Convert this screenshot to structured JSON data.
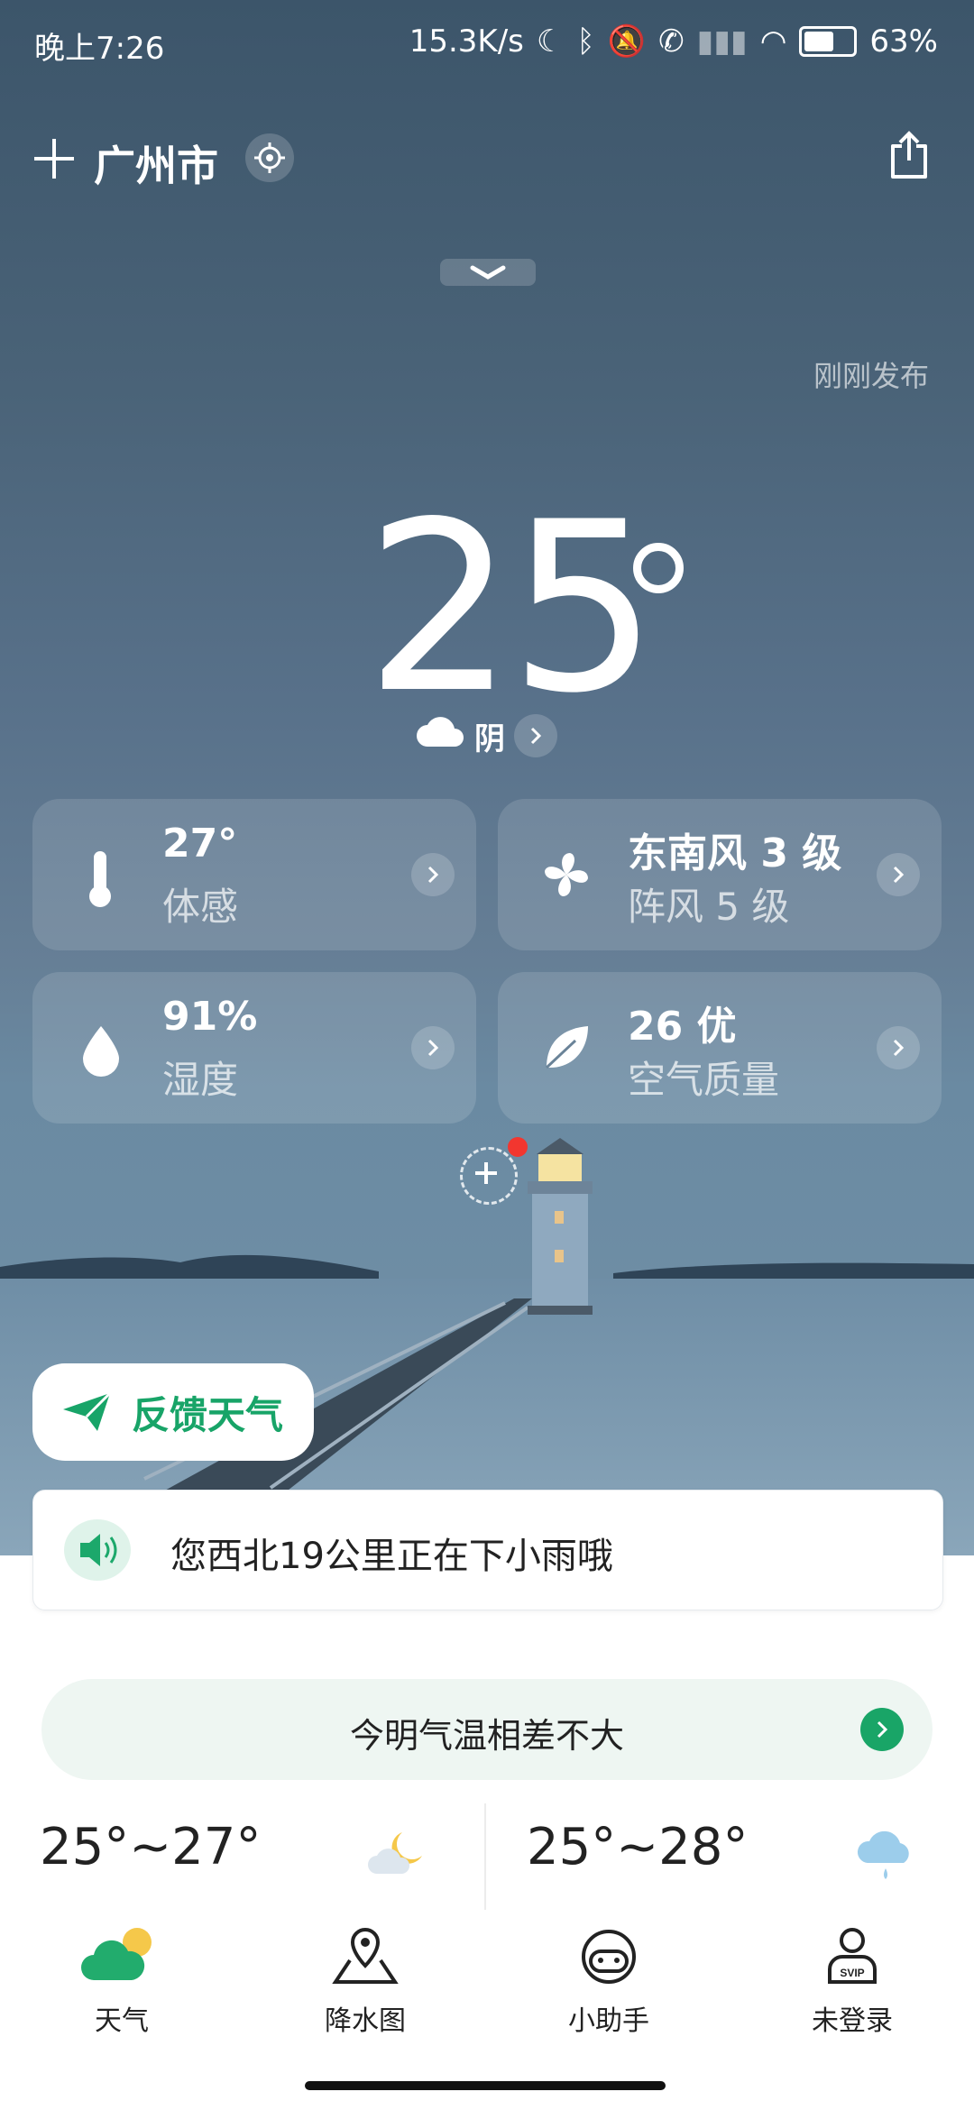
{
  "status_bar": {
    "time": "晚上7:26",
    "network_speed": "15.3K/s",
    "battery": "63%"
  },
  "header": {
    "city": "广州市",
    "published": "刚刚发布"
  },
  "current": {
    "temperature": "25",
    "condition": "阴"
  },
  "cards": [
    {
      "value": "27°",
      "label": "体感",
      "icon": "thermometer-icon"
    },
    {
      "value": "东南风 3 级",
      "label": "阵风 5 级",
      "icon": "fan-icon"
    },
    {
      "value": "91%",
      "label": "湿度",
      "icon": "drop-icon"
    },
    {
      "value": "26 优",
      "label": "空气质量",
      "icon": "leaf-icon"
    }
  ],
  "feedback_button": "反馈天气",
  "alert": "您西北19公里正在下小雨哦",
  "tip": "今明气温相差不大",
  "forecast": [
    {
      "range": "25°~27°",
      "icon": "partly-cloudy-night-icon"
    },
    {
      "range": "25°~28°",
      "icon": "rain-cloud-icon"
    }
  ],
  "nav": [
    {
      "label": "天气",
      "icon": "weather-icon"
    },
    {
      "label": "降水图",
      "icon": "map-pin-icon"
    },
    {
      "label": "小助手",
      "icon": "assistant-icon"
    },
    {
      "label": "未登录",
      "icon": "svip-user-icon"
    }
  ],
  "colors": {
    "accent_green": "#19a567",
    "sky_top": "#3c556a",
    "sky_bottom": "#7392a8"
  }
}
